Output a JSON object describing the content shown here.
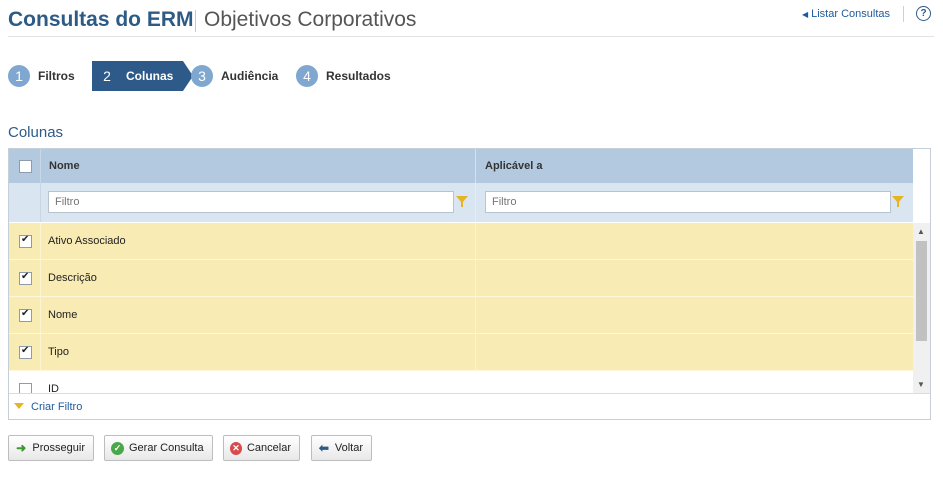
{
  "header": {
    "title": "Consultas do ERM",
    "subtitle": "Objetivos Corporativos",
    "list_link": "Listar Consultas",
    "help": "?"
  },
  "steps": [
    {
      "num": "1",
      "label": "Filtros",
      "active": false
    },
    {
      "num": "2",
      "label": "Colunas",
      "active": true
    },
    {
      "num": "3",
      "label": "Audiência",
      "active": false
    },
    {
      "num": "4",
      "label": "Resultados",
      "active": false
    }
  ],
  "section_title": "Colunas",
  "grid": {
    "columns": [
      "Nome",
      "Aplicável a"
    ],
    "filter_placeholders": [
      "Filtro",
      "Filtro"
    ],
    "rows": [
      {
        "label": "Ativo Associado",
        "checked": true
      },
      {
        "label": "Descrição",
        "checked": true
      },
      {
        "label": "Nome",
        "checked": true
      },
      {
        "label": "Tipo",
        "checked": true
      },
      {
        "label": "ID",
        "checked": false
      }
    ],
    "create_filter": "Criar Filtro"
  },
  "buttons": {
    "proceed": "Prosseguir",
    "generate": "Gerar Consulta",
    "cancel": "Cancelar",
    "back": "Voltar"
  }
}
